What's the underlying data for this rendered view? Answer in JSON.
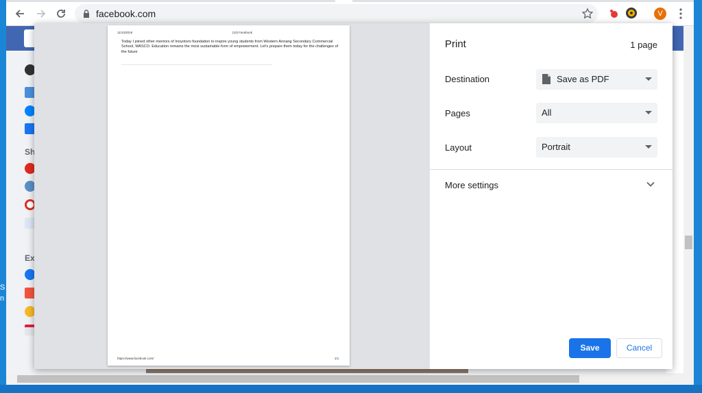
{
  "browser": {
    "url": "facebook.com",
    "avatar_letter": "V"
  },
  "facebook": {
    "sidebar_headers": [
      "Sh",
      "Ex"
    ]
  },
  "preview": {
    "date": "11/13/2019",
    "title": "(10) Facebook",
    "body": "Today I joined other mentors of Inoyotoro foundation to inspire young students from Western Annang Secondary Commercial School, WASCO. Education remains the most sustainable form of empowerment. Let's prepare them today for the challenges of the future",
    "footer_url": "https://www.facebook.com/",
    "page_number": "1/1"
  },
  "print": {
    "title": "Print",
    "page_count": "1 page",
    "destination_label": "Destination",
    "destination_value": "Save as PDF",
    "pages_label": "Pages",
    "pages_value": "All",
    "layout_label": "Layout",
    "layout_value": "Portrait",
    "more_settings": "More settings",
    "save_label": "Save",
    "cancel_label": "Cancel"
  },
  "desktop": {
    "left_edge_chars": [
      "S",
      "n"
    ]
  },
  "colors": {
    "accent": "#1a73e8",
    "facebook_blue": "#4267b2",
    "avatar": "#e8710a"
  }
}
